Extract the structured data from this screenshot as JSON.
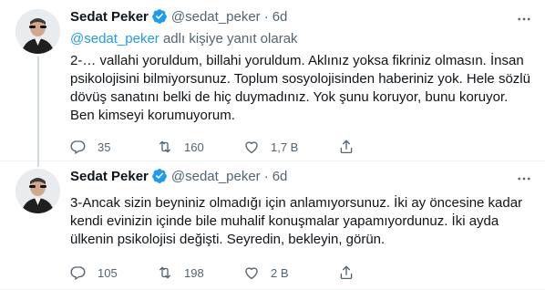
{
  "tweets": [
    {
      "author": {
        "name": "Sedat Peker",
        "handle": "@sedat_peker",
        "verified": true
      },
      "separator": "·",
      "time": "6d",
      "reply_to": {
        "mention": "@sedat_peker",
        "suffix": " adlı kişiye yanıt olarak"
      },
      "text_lines": [
        "2-… vallahi yoruldum, billahi yoruldum.  Aklınız yoksa fikriniz olmasın. İnsan",
        "psikolojisini bilmiyorsunuz. Toplum sosyolojisinden haberiniz yok. Hele sözlü",
        "dövüş sanatını belki de hiç duymadınız. Yok şunu koruyor, bunu koruyor.",
        "Ben kimseyi korumuyorum."
      ],
      "stats": {
        "replies": "35",
        "retweets": "160",
        "likes": "1,7 B"
      }
    },
    {
      "author": {
        "name": "Sedat Peker",
        "handle": "@sedat_peker",
        "verified": true
      },
      "separator": "·",
      "time": "6d",
      "text_lines": [
        "3-Ancak sizin beyniniz olmadığı için anlamıyorsunuz. İki ay öncesine kadar",
        "kendi evinizin içinde bile muhalif konuşmalar yapamıyordunuz. İki ayda",
        "ülkenin psikolojisi değişti. Seyredin, bekleyin, görün."
      ],
      "stats": {
        "replies": "105",
        "retweets": "198",
        "likes": "2 B"
      }
    }
  ],
  "icons": {
    "verified": "verified-badge-icon",
    "more": "more-icon",
    "reply": "reply-icon",
    "retweet": "retweet-icon",
    "like": "heart-icon",
    "share": "share-icon"
  },
  "colors": {
    "accent": "#1d9bf0",
    "secondary_text": "#536471",
    "text": "#0f1419"
  }
}
